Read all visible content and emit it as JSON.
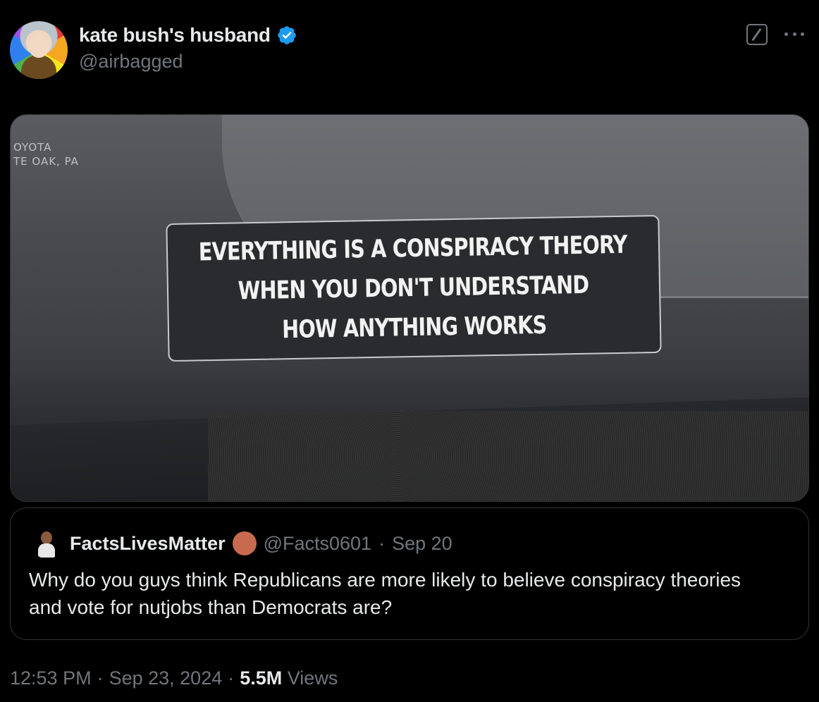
{
  "post": {
    "author": {
      "display_name": "kate bush's husband",
      "handle": "@airbagged",
      "verified": true
    },
    "media": {
      "dealer_plate_lines": [
        "OYOTA",
        "TE OAK, PA"
      ],
      "sticker_lines": [
        "EVERYTHING IS A CONSPIRACY THEORY",
        "WHEN YOU DON'T UNDERSTAND",
        "HOW ANYTHING WORKS"
      ]
    },
    "quoted_post": {
      "display_name": "FactsLivesMatter",
      "handle": "@Facts0601",
      "separator": "·",
      "date": "Sep 20",
      "text": "Why do you guys think Republicans are more likely to believe conspiracy theories and vote for nutjobs than Democrats are?"
    },
    "meta": {
      "time": "12:53 PM",
      "separator": "·",
      "date": "Sep 23, 2024",
      "separator2": "·",
      "views_count": "5.5M",
      "views_label": "Views"
    }
  },
  "colors": {
    "background": "#000000",
    "primary_text": "#e7e9ea",
    "secondary_text": "#71767b",
    "border": "#2f3336",
    "verified_blue": "#1d9bf0",
    "quote_badge": "#c86a50"
  },
  "icons": {
    "verified": "verified-badge-icon",
    "grok": "grok-icon",
    "more": "more-icon"
  }
}
